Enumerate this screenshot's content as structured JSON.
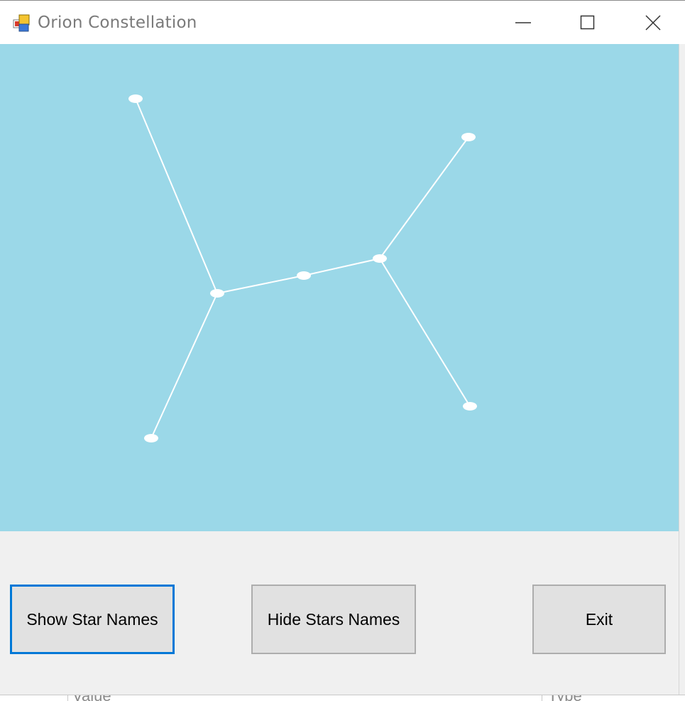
{
  "window": {
    "title": "Orion Constellation"
  },
  "titlebar": {
    "minimize_icon": "minimize-icon",
    "maximize_icon": "maximize-icon",
    "close_icon": "close-icon"
  },
  "canvas": {
    "background": "#9bd8e8",
    "star_color": "#ffffff",
    "line_color": "#ffffff",
    "stars": [
      {
        "id": "s1"
      },
      {
        "id": "s2"
      },
      {
        "id": "s3"
      },
      {
        "id": "s4"
      },
      {
        "id": "s5"
      },
      {
        "id": "s6"
      },
      {
        "id": "s7"
      }
    ]
  },
  "buttons": {
    "show_label": "Show Star Names",
    "hide_label": "Hide Stars Names",
    "exit_label": "Exit"
  },
  "underlying": {
    "value_label": "Value",
    "type_label": "Type"
  }
}
